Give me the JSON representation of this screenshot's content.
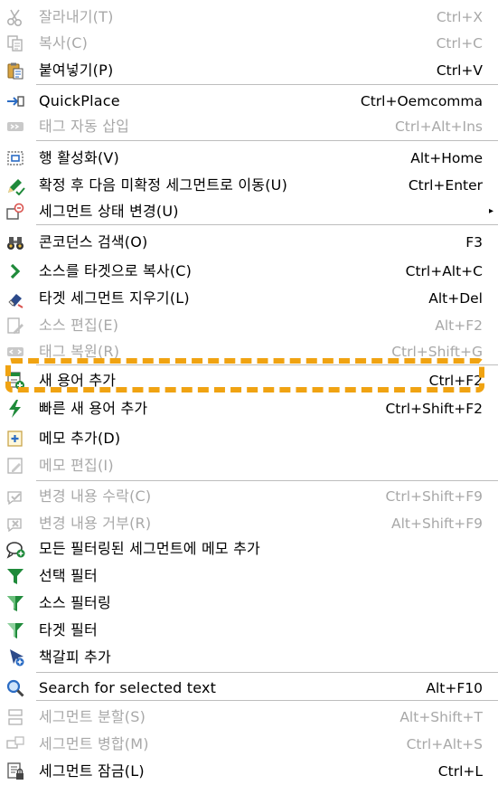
{
  "menu": {
    "items": [
      {
        "name": "cut",
        "icon": "scissors-icon",
        "label": "잘라내기(T)",
        "shortcut": "Ctrl+X",
        "enabled": false
      },
      {
        "name": "copy",
        "icon": "copy-icon",
        "label": "복사(C)",
        "shortcut": "Ctrl+C",
        "enabled": false
      },
      {
        "name": "paste",
        "icon": "paste-icon",
        "label": "붙여넣기(P)",
        "shortcut": "Ctrl+V",
        "enabled": true
      },
      {
        "name": "quickplace",
        "icon": "quickplace-icon",
        "label": "QuickPlace",
        "shortcut": "Ctrl+Oemcomma",
        "enabled": true
      },
      {
        "name": "auto-insert-tags",
        "icon": "tag-insert-icon",
        "label": "태그 자동 삽입",
        "shortcut": "Ctrl+Alt+Ins",
        "enabled": false
      },
      {
        "name": "activate-row",
        "icon": "row-activate-icon",
        "label": "행 활성화(V)",
        "shortcut": "Alt+Home",
        "enabled": true
      },
      {
        "name": "confirm-and-next",
        "icon": "confirm-pencil-icon",
        "label": "확정 후 다음 미확정 세그먼트로 이동(U)",
        "shortcut": "Ctrl+Enter",
        "enabled": true
      },
      {
        "name": "change-segment-status",
        "icon": "segment-status-icon",
        "label": "세그먼트 상태 변경(U)",
        "shortcut": "",
        "enabled": true,
        "submenu": true
      },
      {
        "name": "concordance-search",
        "icon": "binoculars-icon",
        "label": "콘코던스 검색(O)",
        "shortcut": "F3",
        "enabled": true
      },
      {
        "name": "copy-source-to-target",
        "icon": "chevron-right-icon",
        "label": "소스를 타겟으로 복사(C)",
        "shortcut": "Ctrl+Alt+C",
        "enabled": true
      },
      {
        "name": "clear-target-segment",
        "icon": "eraser-icon",
        "label": "타겟 세그먼트 지우기(L)",
        "shortcut": "Alt+Del",
        "enabled": true
      },
      {
        "name": "edit-source",
        "icon": "edit-source-icon",
        "label": "소스 편집(E)",
        "shortcut": "Alt+F2",
        "enabled": false
      },
      {
        "name": "restore-tags",
        "icon": "tag-restore-icon",
        "label": "태그 복원(R)",
        "shortcut": "Ctrl+Shift+G",
        "enabled": false
      },
      {
        "name": "add-new-term",
        "icon": "add-term-icon",
        "label": "새 용어 추가",
        "shortcut": "Ctrl+F2",
        "enabled": true
      },
      {
        "name": "quick-add-new-term",
        "icon": "lightning-icon",
        "label": "빠른 새 용어 추가",
        "shortcut": "Ctrl+Shift+F2",
        "enabled": true
      },
      {
        "name": "add-comment",
        "icon": "add-comment-icon",
        "label": "메모 추가(D)",
        "shortcut": "",
        "enabled": true
      },
      {
        "name": "edit-comment",
        "icon": "edit-comment-icon",
        "label": "메모 편집(I)",
        "shortcut": "",
        "enabled": false
      },
      {
        "name": "accept-change",
        "icon": "accept-change-icon",
        "label": "변경 내용 수락(C)",
        "shortcut": "Ctrl+Shift+F9",
        "enabled": false
      },
      {
        "name": "reject-change",
        "icon": "reject-change-icon",
        "label": "변경 내용 거부(R)",
        "shortcut": "Alt+Shift+F9",
        "enabled": false
      },
      {
        "name": "comment-all-filtered",
        "icon": "comment-filtered-icon",
        "label": "모든 필터링된 세그먼트에 메모 추가",
        "shortcut": "",
        "enabled": true
      },
      {
        "name": "selection-filter",
        "icon": "filter-icon",
        "label": "선택 필터",
        "shortcut": "",
        "enabled": true
      },
      {
        "name": "source-filter",
        "icon": "filter-source-icon",
        "label": "소스 필터링",
        "shortcut": "",
        "enabled": true
      },
      {
        "name": "target-filter",
        "icon": "filter-target-icon",
        "label": "타겟 필터",
        "shortcut": "",
        "enabled": true
      },
      {
        "name": "add-bookmark",
        "icon": "bookmark-add-icon",
        "label": "책갈피 추가",
        "shortcut": "",
        "enabled": true
      },
      {
        "name": "search-selected-text",
        "icon": "magnifier-icon",
        "label": "Search for selected text",
        "shortcut": "Alt+F10",
        "enabled": true
      },
      {
        "name": "split-segment",
        "icon": "split-segment-icon",
        "label": "세그먼트 분할(S)",
        "shortcut": "Alt+Shift+T",
        "enabled": false
      },
      {
        "name": "merge-segments",
        "icon": "merge-segment-icon",
        "label": "세그먼트 병합(M)",
        "shortcut": "Ctrl+Alt+S",
        "enabled": false
      },
      {
        "name": "lock-segment",
        "icon": "lock-segment-icon",
        "label": "세그먼트 잠금(L)",
        "shortcut": "Ctrl+L",
        "enabled": true
      }
    ],
    "highlighted_item": "add-new-term",
    "colors": {
      "highlight_border": "#f0a312",
      "disabled_text": "#a8a8a8",
      "icon_green": "#1f8a3a",
      "icon_blue": "#2b6cc4",
      "separator": "#bdbdbd"
    }
  }
}
